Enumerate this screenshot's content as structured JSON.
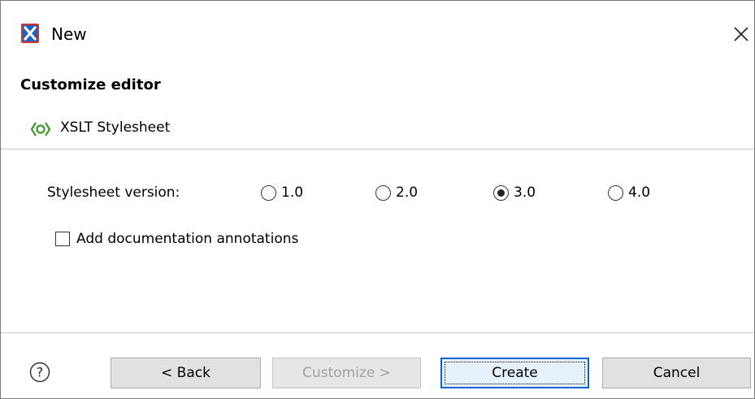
{
  "window": {
    "title": "New"
  },
  "header": {
    "title": "Customize editor",
    "subtitle": "XSLT Stylesheet"
  },
  "version": {
    "label": "Stylesheet version:",
    "options": [
      {
        "label": "1.0",
        "selected": false
      },
      {
        "label": "2.0",
        "selected": false
      },
      {
        "label": "3.0",
        "selected": true
      },
      {
        "label": "4.0",
        "selected": false
      }
    ]
  },
  "checkbox": {
    "label": "Add documentation annotations",
    "checked": false
  },
  "buttons": {
    "back": "< Back",
    "customize": "Customize >",
    "create": "Create",
    "cancel": "Cancel"
  },
  "icons": {
    "app": "oxygen-x-icon",
    "xslt": "xslt-file-icon",
    "close": "close-icon",
    "help": "help-icon"
  },
  "colors": {
    "accent": "#0a64d8",
    "app_icon": "#d6322a",
    "xslt_icon": "#3a9a25"
  }
}
